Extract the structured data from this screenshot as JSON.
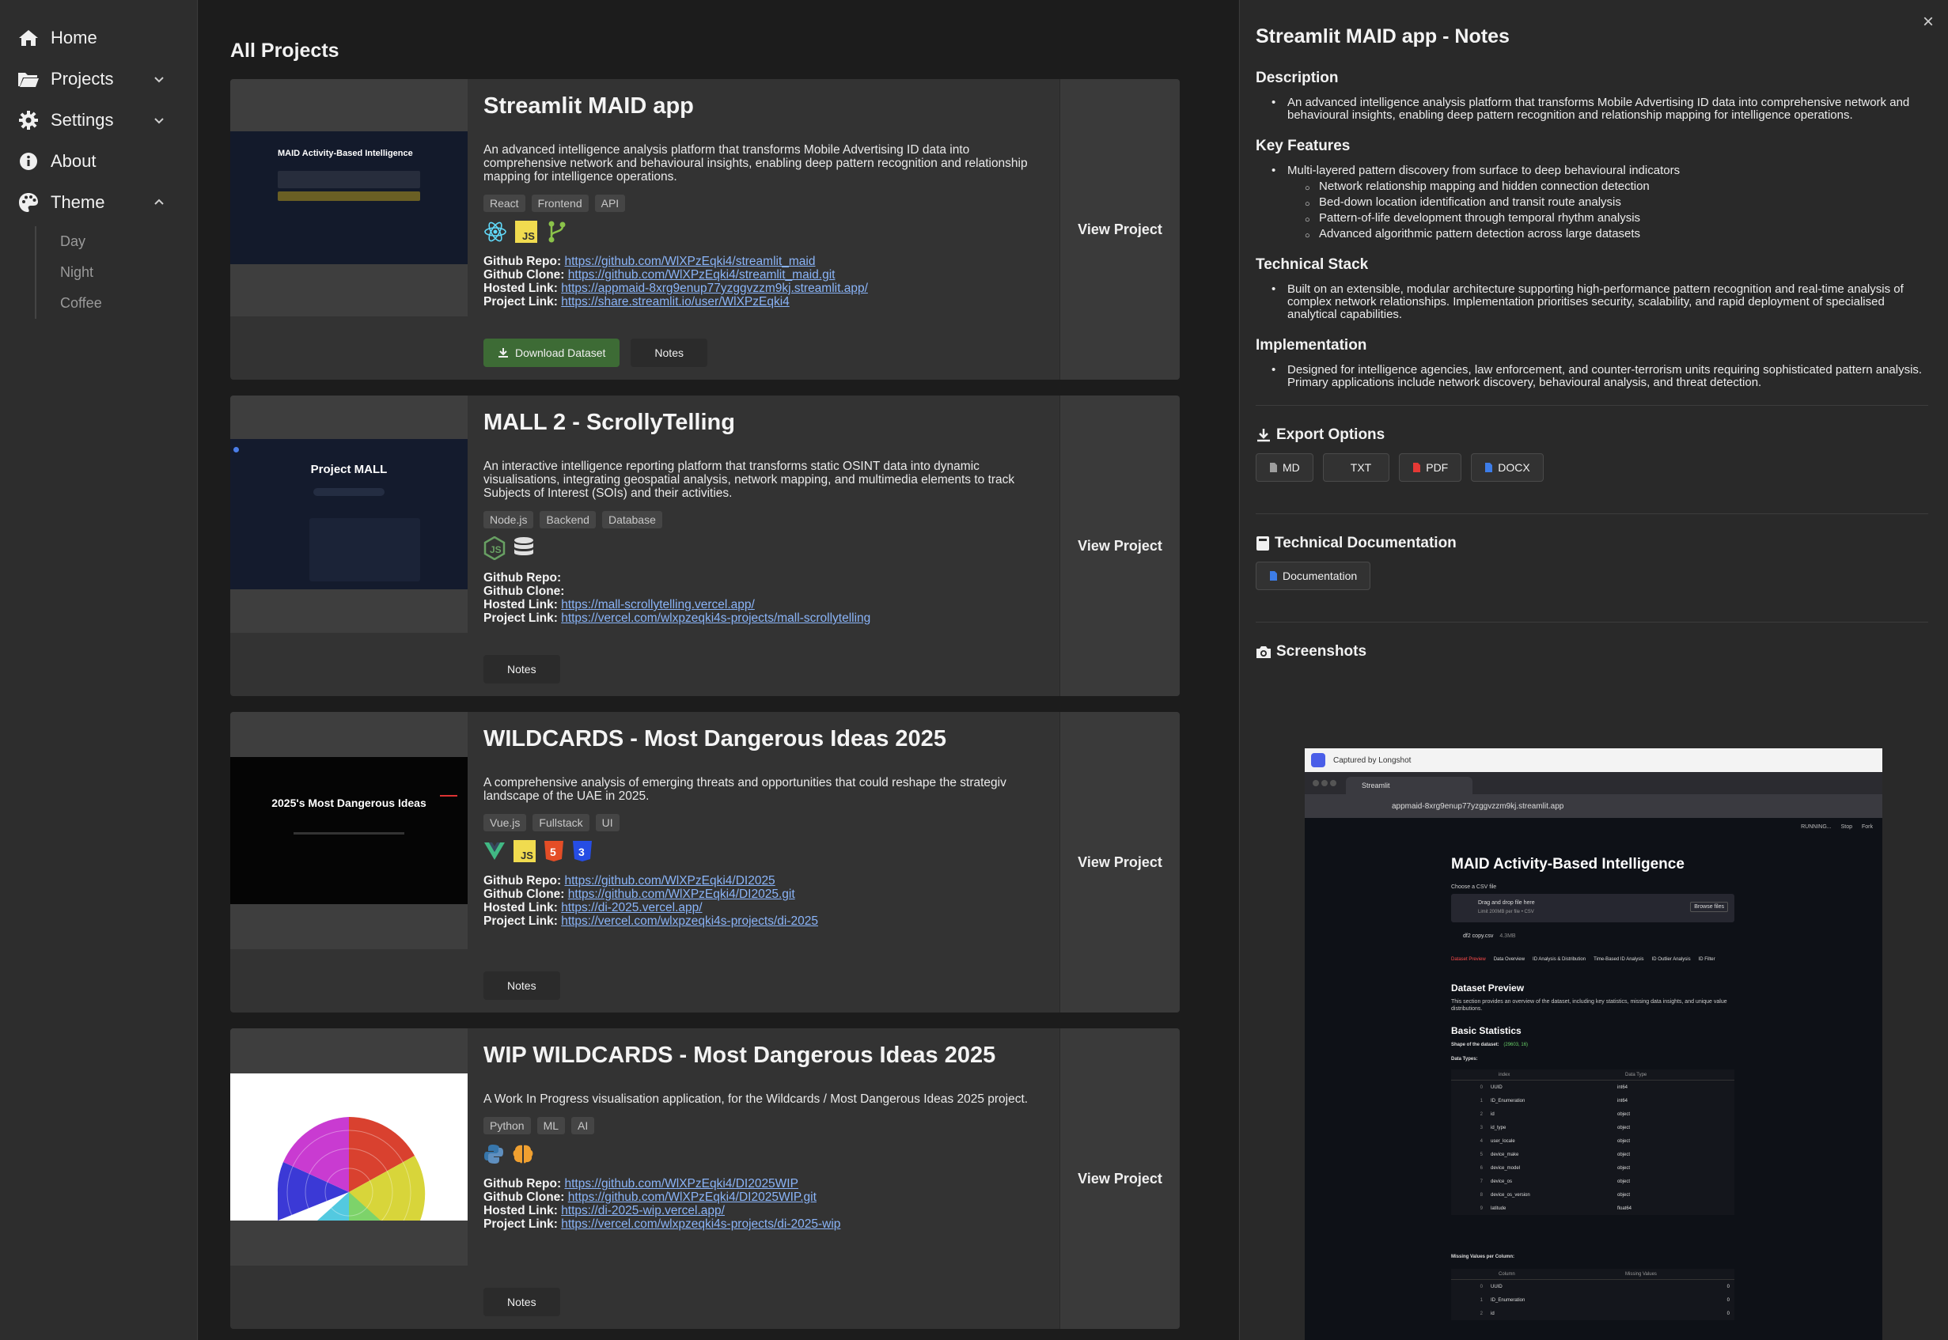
{
  "sidebar": {
    "items": [
      {
        "label": "Home",
        "icon": "home-icon"
      },
      {
        "label": "Projects",
        "icon": "folder-icon"
      },
      {
        "label": "Settings",
        "icon": "gear-icon"
      },
      {
        "label": "About",
        "icon": "info-icon"
      },
      {
        "label": "Theme",
        "icon": "palette-icon"
      }
    ],
    "theme_options": [
      "Day",
      "Night",
      "Coffee"
    ]
  },
  "main": {
    "title": "All Projects",
    "view_label": "View Project",
    "notes_label": "Notes",
    "download_label": "Download Dataset",
    "link_labels": {
      "repo": "Github Repo:",
      "clone": "Github Clone:",
      "hosted": "Hosted Link:",
      "project": "Project Link:"
    },
    "projects": [
      {
        "title": "Streamlit MAID app",
        "description": "An advanced intelligence analysis platform that transforms Mobile Advertising ID data into comprehensive network and behavioural insights, enabling deep pattern recognition and relationship mapping for intelligence operations.",
        "tags": [
          "React",
          "Frontend",
          "API"
        ],
        "icons": [
          "react-icon",
          "javascript-icon",
          "git-branch-icon"
        ],
        "repo": "https://github.com/WlXPzEqki4/streamlit_maid",
        "clone": "https://github.com/WlXPzEqki4/streamlit_maid.git",
        "hosted": "https://appmaid-8xrg9enup77yzggvzzm9kj.streamlit.app/",
        "project": "https://share.streamlit.io/user/WlXPzEqki4",
        "thumb_title": "MAID Activity-Based Intelligence"
      },
      {
        "title": "MALL 2 - ScrollyTelling",
        "description": "An interactive intelligence reporting platform that transforms static OSINT data into dynamic visualisations, integrating geospatial analysis, network mapping, and multimedia elements to track Subjects of Interest (SOIs) and their activities.",
        "tags": [
          "Node.js",
          "Backend",
          "Database"
        ],
        "icons": [
          "nodejs-icon",
          "database-icon"
        ],
        "repo": "",
        "clone": "",
        "hosted": "https://mall-scrollytelling.vercel.app/",
        "project": "https://vercel.com/wlxpzeqki4s-projects/mall-scrollytelling",
        "thumb_title": "Project MALL"
      },
      {
        "title": "WILDCARDS - Most Dangerous Ideas 2025",
        "description": "A comprehensive analysis of emerging threats and opportunities that could reshape the strategiv landscape of the UAE in 2025.",
        "tags": [
          "Vue.js",
          "Fullstack",
          "UI"
        ],
        "icons": [
          "vue-icon",
          "javascript-icon",
          "html5-icon",
          "css3-icon"
        ],
        "repo": "https://github.com/WlXPzEqki4/DI2025",
        "clone": "https://github.com/WlXPzEqki4/DI2025.git",
        "hosted": "https://di-2025.vercel.app/",
        "project": "https://vercel.com/wlxpzeqki4s-projects/di-2025",
        "thumb_title": "2025's Most Dangerous Ideas"
      },
      {
        "title": "WIP WILDCARDS - Most Dangerous Ideas 2025",
        "description": "A Work In Progress visualisation application, for the Wildcards / Most Dangerous Ideas 2025 project.",
        "tags": [
          "Python",
          "ML",
          "AI"
        ],
        "icons": [
          "python-icon",
          "brain-icon"
        ],
        "repo": "https://github.com/WlXPzEqki4/DI2025WIP",
        "clone": "https://github.com/WlXPzEqki4/DI2025WIP.git",
        "hosted": "https://di-2025-wip.vercel.app/",
        "project": "https://vercel.com/wlxpzeqki4s-projects/di-2025-wip",
        "thumb_title": ""
      }
    ]
  },
  "notes": {
    "title": "Streamlit MAID app - Notes",
    "close": "×",
    "description_h": "Description",
    "description": "An advanced intelligence analysis platform that transforms Mobile Advertising ID data into comprehensive network and behavioural insights, enabling deep pattern recognition and relationship mapping for intelligence operations.",
    "features_h": "Key Features",
    "feature_main": "Multi-layered pattern discovery from surface to deep behavioural indicators",
    "feature_subs": [
      "Network relationship mapping and hidden connection detection",
      "Bed-down location identification and transit route analysis",
      "Pattern-of-life development through temporal rhythm analysis",
      "Advanced algorithmic pattern detection across large datasets"
    ],
    "stack_h": "Technical Stack",
    "stack": "Built on an extensible, modular architecture supporting high-performance pattern recognition and real-time analysis of complex network relationships. Implementation prioritises security, scalability, and rapid deployment of specialised analytical capabilities.",
    "impl_h": "Implementation",
    "impl": "Designed for intelligence agencies, law enforcement, and counter-terrorism units requiring sophisticated pattern analysis. Primary applications include network discovery, behavioural analysis, and threat detection.",
    "export_h": "Export Options",
    "export_buttons": [
      "MD",
      "TXT",
      "PDF",
      "DOCX"
    ],
    "docs_h": "Technical Documentation",
    "docs_button": "Documentation",
    "screens_h": "Screenshots",
    "screenshot": {
      "banner": "Captured by Longshot",
      "tab": "Streamlit",
      "url": "appmaid-8xrg9enup77yzggvzzm9kj.streamlit.app",
      "status": "RUNNING...",
      "stop": "Stop",
      "fork": "Fork",
      "app_title": "MAID Activity-Based Intelligence",
      "choose": "Choose a CSV file",
      "drop": "Drag and drop file here",
      "limit": "Limit 200MB per file • CSV",
      "browse": "Browse files",
      "file": "df2 copy.csv",
      "file_size": "4.3MB",
      "tabs": [
        "Dataset Preview",
        "Data Overview",
        "ID Analysis & Distribution",
        "Time-Based ID Analysis",
        "ID Outlier Analysis",
        "ID Filter"
      ],
      "preview_h": "Dataset Preview",
      "preview_text": "This section provides an overview of the dataset, including key statistics, missing data insights, and unique value distributions.",
      "basic_h": "Basic Statistics",
      "shape_label": "Shape of the dataset:",
      "shape_value": "(29603, 16)",
      "dtypes_label": "Data Types:",
      "dtype_headers": [
        "index",
        "Data Type"
      ],
      "dtype_rows": [
        [
          "0",
          "UUID",
          "int64"
        ],
        [
          "1",
          "ID_Enumeration",
          "int64"
        ],
        [
          "2",
          "id",
          "object"
        ],
        [
          "3",
          "id_type",
          "object"
        ],
        [
          "4",
          "user_locale",
          "object"
        ],
        [
          "5",
          "device_make",
          "object"
        ],
        [
          "6",
          "device_model",
          "object"
        ],
        [
          "7",
          "device_os",
          "object"
        ],
        [
          "8",
          "device_os_version",
          "object"
        ],
        [
          "9",
          "latitude",
          "float64"
        ]
      ],
      "missing_label": "Missing Values per Column:",
      "missing_headers": [
        "Column",
        "Missing Values"
      ],
      "missing_rows": [
        [
          "0",
          "UUID",
          "0"
        ],
        [
          "1",
          "ID_Enumeration",
          "0"
        ],
        [
          "2",
          "id",
          "0"
        ]
      ]
    }
  }
}
